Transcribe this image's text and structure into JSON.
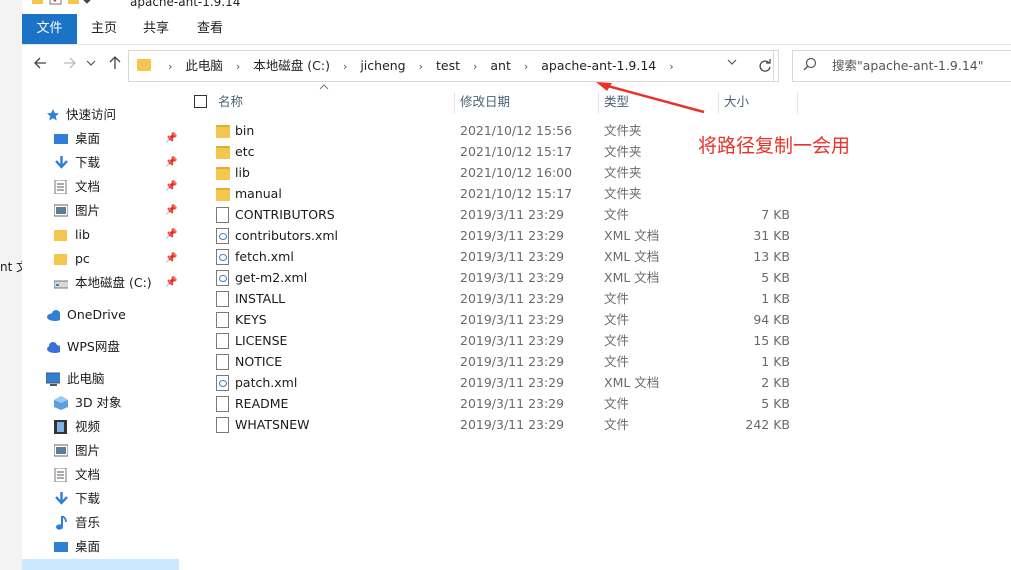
{
  "window": {
    "title": "apache-ant-1.9.14"
  },
  "left_fragment": "nt 文",
  "ribbon": {
    "tabs": [
      "文件",
      "主页",
      "共享",
      "查看"
    ]
  },
  "address": {
    "crumbs": [
      "此电脑",
      "本地磁盘 (C:)",
      "jicheng",
      "test",
      "ant",
      "apache-ant-1.9.14"
    ]
  },
  "search": {
    "placeholder": "搜索\"apache-ant-1.9.14\""
  },
  "nav": {
    "quick_access": "快速访问",
    "items": [
      {
        "label": "桌面",
        "icon": "desktop-icon",
        "pinned": true
      },
      {
        "label": "下载",
        "icon": "download-icon",
        "pinned": true
      },
      {
        "label": "文档",
        "icon": "document-icon",
        "pinned": true
      },
      {
        "label": "图片",
        "icon": "pictures-icon",
        "pinned": true
      },
      {
        "label": "lib",
        "icon": "folder-icon",
        "pinned": true
      },
      {
        "label": "pc",
        "icon": "folder-icon",
        "pinned": true
      },
      {
        "label": "本地磁盘 (C:)",
        "icon": "drive-icon",
        "pinned": true
      }
    ],
    "onedrive": "OneDrive",
    "wps": "WPS网盘",
    "this_pc": "此电脑",
    "pc_items": [
      {
        "label": "3D 对象",
        "icon": "3d-objects-icon"
      },
      {
        "label": "视频",
        "icon": "video-icon"
      },
      {
        "label": "图片",
        "icon": "pictures-icon"
      },
      {
        "label": "文档",
        "icon": "document-icon"
      },
      {
        "label": "下载",
        "icon": "download-icon"
      },
      {
        "label": "音乐",
        "icon": "music-icon"
      },
      {
        "label": "桌面",
        "icon": "desktop-icon"
      }
    ]
  },
  "columns": {
    "name": "名称",
    "date": "修改日期",
    "type": "类型",
    "size": "大小"
  },
  "files": [
    {
      "name": "bin",
      "date": "2021/10/12 15:56",
      "type": "文件夹",
      "size": "",
      "kind": "folder"
    },
    {
      "name": "etc",
      "date": "2021/10/12 15:17",
      "type": "文件夹",
      "size": "",
      "kind": "folder"
    },
    {
      "name": "lib",
      "date": "2021/10/12 16:00",
      "type": "文件夹",
      "size": "",
      "kind": "folder"
    },
    {
      "name": "manual",
      "date": "2021/10/12 15:17",
      "type": "文件夹",
      "size": "",
      "kind": "folder"
    },
    {
      "name": "CONTRIBUTORS",
      "date": "2019/3/11 23:29",
      "type": "文件",
      "size": "7 KB",
      "kind": "file"
    },
    {
      "name": "contributors.xml",
      "date": "2019/3/11 23:29",
      "type": "XML 文档",
      "size": "31 KB",
      "kind": "xml"
    },
    {
      "name": "fetch.xml",
      "date": "2019/3/11 23:29",
      "type": "XML 文档",
      "size": "13 KB",
      "kind": "xml"
    },
    {
      "name": "get-m2.xml",
      "date": "2019/3/11 23:29",
      "type": "XML 文档",
      "size": "5 KB",
      "kind": "xml"
    },
    {
      "name": "INSTALL",
      "date": "2019/3/11 23:29",
      "type": "文件",
      "size": "1 KB",
      "kind": "file"
    },
    {
      "name": "KEYS",
      "date": "2019/3/11 23:29",
      "type": "文件",
      "size": "94 KB",
      "kind": "file"
    },
    {
      "name": "LICENSE",
      "date": "2019/3/11 23:29",
      "type": "文件",
      "size": "15 KB",
      "kind": "file"
    },
    {
      "name": "NOTICE",
      "date": "2019/3/11 23:29",
      "type": "文件",
      "size": "1 KB",
      "kind": "file"
    },
    {
      "name": "patch.xml",
      "date": "2019/3/11 23:29",
      "type": "XML 文档",
      "size": "2 KB",
      "kind": "xml"
    },
    {
      "name": "README",
      "date": "2019/3/11 23:29",
      "type": "文件",
      "size": "5 KB",
      "kind": "file"
    },
    {
      "name": "WHATSNEW",
      "date": "2019/3/11 23:29",
      "type": "文件",
      "size": "242 KB",
      "kind": "file"
    }
  ],
  "annotation": {
    "text": "将路径复制一会用",
    "color": "#e8332a"
  }
}
